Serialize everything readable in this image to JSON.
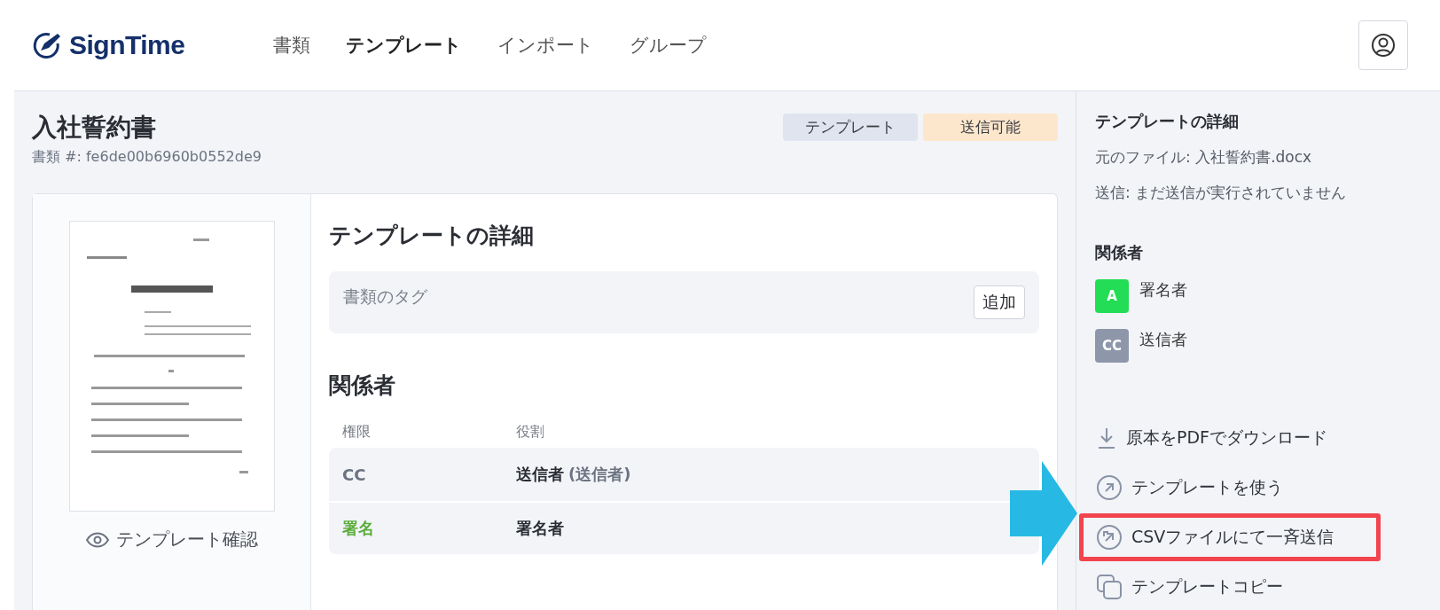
{
  "header": {
    "logo": "SignTime",
    "nav": [
      {
        "label": "書類",
        "selected": false
      },
      {
        "label": "テンプレート",
        "selected": true
      },
      {
        "label": "インポート",
        "selected": false
      },
      {
        "label": "グループ",
        "selected": false
      }
    ]
  },
  "document": {
    "title": "入社誓約書",
    "number": "書類 #: fe6de00b6960b0552de9",
    "badges": [
      {
        "label": "テンプレート",
        "kind": "type"
      },
      {
        "label": "送信可能",
        "kind": "status"
      }
    ],
    "preview_link": "テンプレート確認",
    "details": {
      "heading": "テンプレートの詳細",
      "tags_label": "書類のタグ",
      "add_button": "追加"
    },
    "parties": {
      "heading": "関係者",
      "columns": [
        "権限",
        "役割"
      ],
      "rows": [
        {
          "permission": "CC",
          "kind": "cc",
          "role": "送信者",
          "role_note": "(送信者)"
        },
        {
          "permission": "署名",
          "kind": "sign",
          "role": "署名者"
        }
      ]
    }
  },
  "sidebar": {
    "heading": "テンプレートの詳細",
    "file": "元のファイル: 入社誓約書.docx",
    "sent": "送信: まだ送信が実行されていません",
    "parties_heading": "関係者",
    "parties": [
      {
        "avatar": "A",
        "name": "署名者",
        "color": "#22dd55"
      },
      {
        "avatar": "CC",
        "name": "送信者",
        "color": "#8e97aa"
      }
    ],
    "actions": [
      {
        "label": "原本をPDFでダウンロード",
        "kind": "download",
        "highlighted": false
      },
      {
        "label": "テンプレートを使う",
        "kind": "use",
        "highlighted": false
      },
      {
        "label": "CSVファイルにて一斉送信",
        "kind": "bulk",
        "highlighted": true
      },
      {
        "label": "テンプレートコピー",
        "kind": "copy",
        "highlighted": false
      }
    ]
  }
}
